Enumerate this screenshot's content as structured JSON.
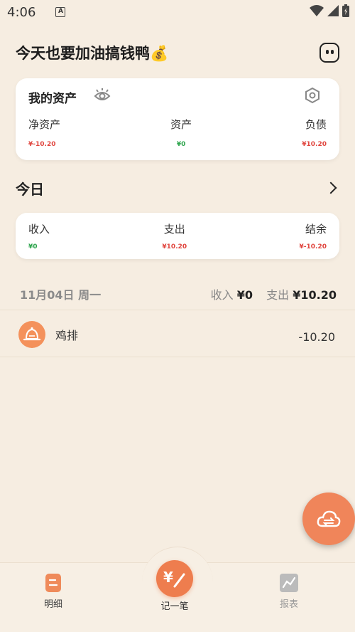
{
  "status_bar": {
    "time": "4:06",
    "notif_letter": "A"
  },
  "header": {
    "title": "今天也要加油搞钱鸭💰"
  },
  "assets": {
    "title": "我的资产",
    "net_label": "净资产",
    "net_value": "¥-10.20",
    "asset_label": "资产",
    "asset_value": "¥0",
    "debt_label": "负债",
    "debt_value": "¥10.20"
  },
  "today": {
    "title": "今日",
    "income_label": "收入",
    "income_value": "¥0",
    "expense_label": "支出",
    "expense_value": "¥10.20",
    "balance_label": "结余",
    "balance_value": "¥-10.20"
  },
  "day_group": {
    "date": "11月04日 周一",
    "income_label": "收入",
    "income_value": "¥0",
    "expense_label": "支出",
    "expense_value": "¥10.20",
    "entries": [
      {
        "name": "鸡排",
        "amount": "-10.20",
        "icon": "bell-icon"
      }
    ]
  },
  "nav": {
    "detail": "明细",
    "record": "记一笔",
    "report": "报表"
  },
  "colors": {
    "accent": "#ee7d4e",
    "expense_red": "#e0453e",
    "income_green": "#2ba44b",
    "background": "#f6ede1"
  }
}
